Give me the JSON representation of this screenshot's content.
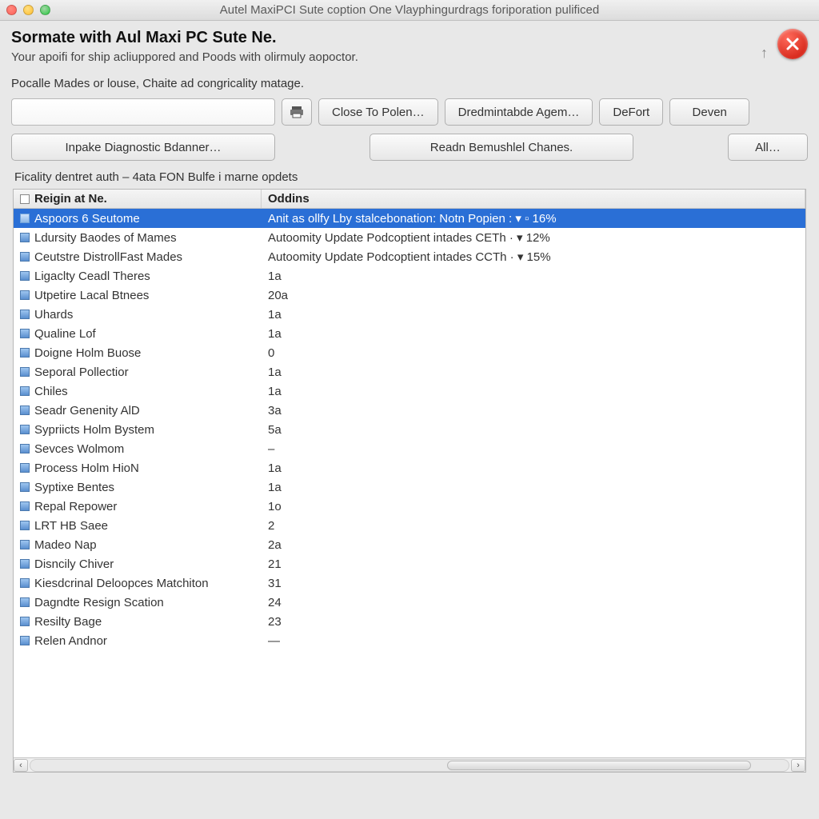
{
  "window": {
    "title": "Autel MaxiPCI Sute coption One Vlayphingurdrags foriporation pulificed"
  },
  "header": {
    "title": "Sormate with Aul Maxi PC Sute Ne.",
    "subtitle": "Your apoifi for ship acliuppored and Poods with olirmuly aopoctor."
  },
  "line2": "Pocalle Mades or louse, Chaite ad congricality matage.",
  "toolbar": {
    "search_value": "",
    "btn_print_aria": "Print",
    "btn_close_to": "Close To Polen…",
    "btn_dred": "Dredmintabde Agem…",
    "btn_defort": "DeFort",
    "btn_deven": "Deven",
    "btn_inpake": "Inpake Diagnostic Bdanner…",
    "btn_readn": "Readn Bemushlel Chanes.",
    "btn_all": "All…"
  },
  "panel_caption": "Ficality dentret auth – 4ata FON Bulfe i marne opdets",
  "columns": {
    "name": "Reigin at Ne.",
    "odd": "Oddins"
  },
  "rows": [
    {
      "name": "Aspoors 6 Seutome",
      "odd": "Anit as ollfy Lby stalcebonation:  Notn Popien : ▾ ▫ 16%",
      "selected": true
    },
    {
      "name": "Ldursity Baodes of Mames",
      "odd": "Autoomity Update Podcoptient intades CETh · ▾ 12%"
    },
    {
      "name": "Ceutstre DistrollFast Mades",
      "odd": "Autoomity Update Podcoptient intades CCTh · ▾ 15%"
    },
    {
      "name": "Ligaclty Ceadl Theres",
      "odd": "1a"
    },
    {
      "name": "Utpetire Lacal Btnees",
      "odd": "20a"
    },
    {
      "name": "Uhards",
      "odd": "1a"
    },
    {
      "name": "Qualine Lof",
      "odd": "1a"
    },
    {
      "name": "Doigne Holm Buose",
      "odd": "0"
    },
    {
      "name": "Seporal Pollectior",
      "odd": "1a"
    },
    {
      "name": "Chiles",
      "odd": "1a"
    },
    {
      "name": "Seadr Genenity AlD",
      "odd": "3a"
    },
    {
      "name": "Sypriicts Holm Bystem",
      "odd": "5a"
    },
    {
      "name": "Sevces Wolmom",
      "odd": "–"
    },
    {
      "name": "Process Holm HioN",
      "odd": "1a"
    },
    {
      "name": "Syptixe Bentes",
      "odd": "1a"
    },
    {
      "name": "Repal Repower",
      "odd": "1o"
    },
    {
      "name": "LRT HB Saee",
      "odd": "2"
    },
    {
      "name": "Madeo Nap",
      "odd": "2a"
    },
    {
      "name": "Disncily Chiver",
      "odd": "21"
    },
    {
      "name": "Kiesdcrinal Deloopces Matchiton",
      "odd": "31"
    },
    {
      "name": "Dagndte Resign Scation",
      "odd": "24"
    },
    {
      "name": "Resilty Bage",
      "odd": "23"
    },
    {
      "name": "Relen Andnor",
      "odd": "—"
    }
  ]
}
